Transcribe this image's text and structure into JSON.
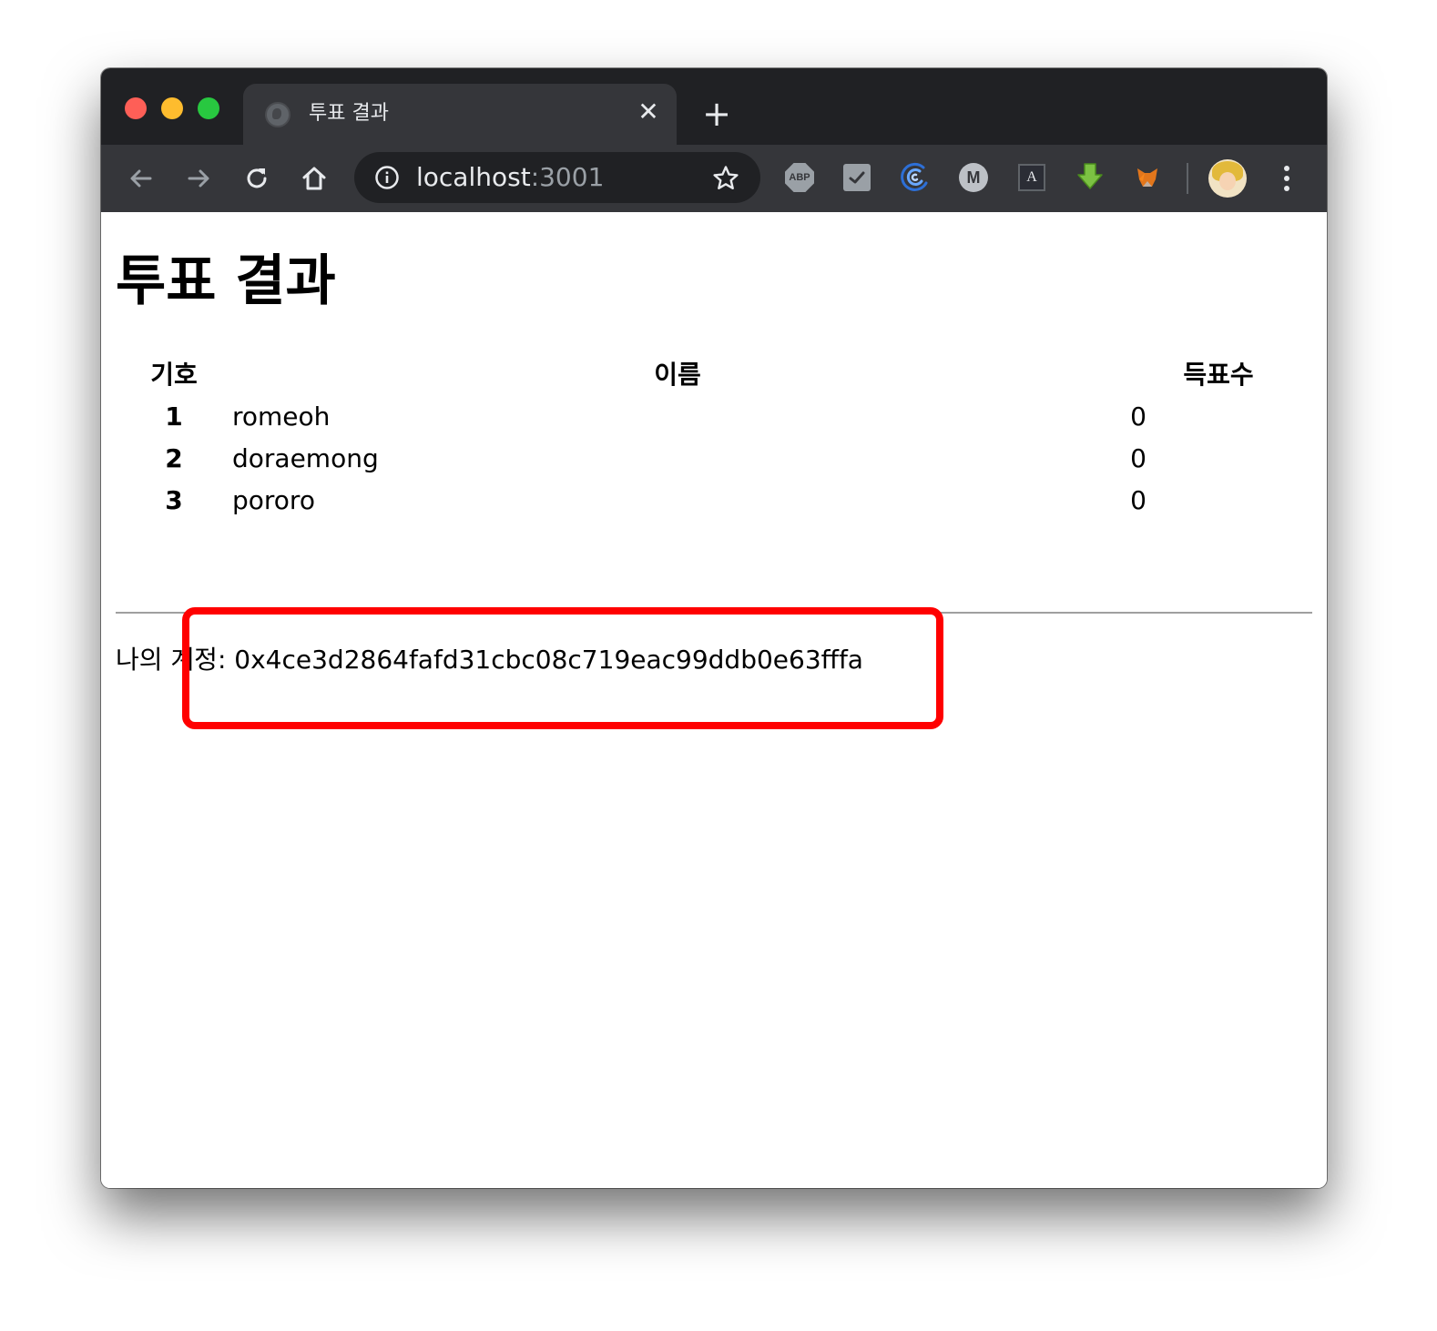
{
  "browser": {
    "tab_title": "투표 결과",
    "tab_close_glyph": "✕",
    "new_tab_glyph": "+",
    "url_host": "localhost",
    "url_port": ":3001",
    "extensions": {
      "abp_label": "ABP",
      "m_label": "M",
      "a_label": "A"
    }
  },
  "page": {
    "title": "투표 결과",
    "table": {
      "headers": {
        "symbol": "기호",
        "name": "이름",
        "votes": "득표수"
      },
      "rows": [
        {
          "symbol": "1",
          "name": "romeoh",
          "votes": "0"
        },
        {
          "symbol": "2",
          "name": "doraemong",
          "votes": "0"
        },
        {
          "symbol": "3",
          "name": "pororo",
          "votes": "0"
        }
      ]
    },
    "account_label": "나의 계정: ",
    "account_address": "0x4ce3d2864fafd31cbc08c719eac99ddb0e63fffa"
  },
  "colors": {
    "tab_strip": "#202124",
    "toolbar": "#35363a",
    "highlight": "#ff0000"
  }
}
